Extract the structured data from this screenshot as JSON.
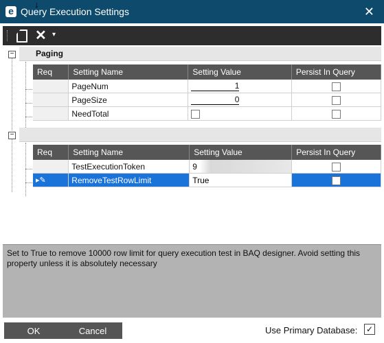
{
  "window": {
    "title": "Query Execution Settings",
    "close": "✕"
  },
  "toolbar": {
    "new_icon": "new-document-icon",
    "delete_icon": "delete-x-icon",
    "dropdown": "▾"
  },
  "groups": [
    {
      "name": "Paging",
      "expander": "−",
      "headers": [
        "Req",
        "Setting Name",
        "Setting Value",
        "Persist In Query"
      ],
      "rows": [
        {
          "name": "PageNum",
          "value": "1",
          "value_type": "number",
          "persist": false
        },
        {
          "name": "PageSize",
          "value": "0",
          "value_type": "number",
          "persist": false
        },
        {
          "name": "NeedTotal",
          "value": "",
          "value_type": "checkbox",
          "persist": false
        }
      ]
    },
    {
      "name": "",
      "expander": "−",
      "headers": [
        "Req",
        "Setting Name",
        "Setting Value",
        "Persist In Query"
      ],
      "rows": [
        {
          "name": "TestExecutionToken",
          "value": "9",
          "value_type": "text",
          "persist": false
        },
        {
          "name": "RemoveTestRowLimit",
          "value": "True",
          "value_type": "text",
          "persist": false,
          "selected": true
        }
      ]
    }
  ],
  "description": "Set to True to remove 10000 row limit for query execution test in BAQ designer. Avoid setting this property unless it is absolutely necessary",
  "buttons": {
    "ok": "OK",
    "cancel": "Cancel"
  },
  "use_primary_database": {
    "label": "Use Primary Database:",
    "checked": true,
    "mark": "✓"
  },
  "colors": {
    "titlebar": "#0e4a6b",
    "header": "#565656",
    "selected": "#1a73d9",
    "description_bg": "#b3b3b3"
  }
}
